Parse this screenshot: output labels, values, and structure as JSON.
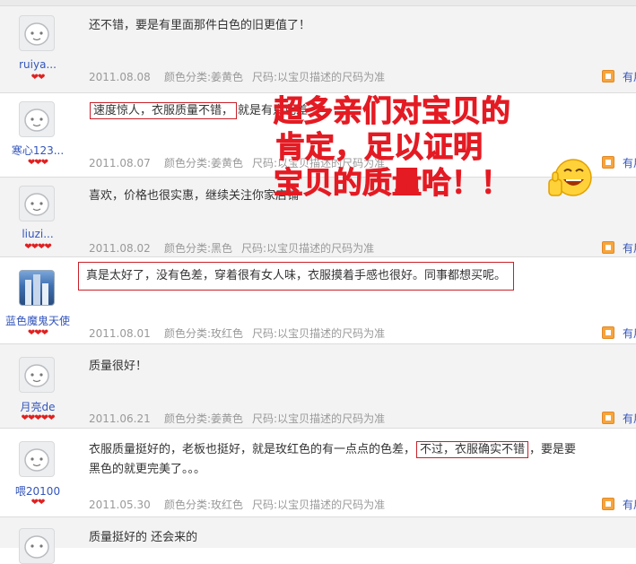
{
  "reviews": [
    {
      "user": "ruiya...",
      "hearts": "❤❤",
      "content": "还不错，要是有里面那件白色的旧更值了！",
      "date": "2011.08.08",
      "color": "颜色分类:姜黄色",
      "size": "尺码:以宝贝描述的尺码为准",
      "link": "有用"
    },
    {
      "user": "寒心123...",
      "hearts": "❤❤❤",
      "content_highlight": "速度惊人，衣服质量不错，",
      "content_rest": "就是有点色差",
      "date": "2011.08.07",
      "color": "颜色分类:姜黄色",
      "size": "尺码:以宝贝描述的尺码为准",
      "link": "有用"
    },
    {
      "user": "liuzi...",
      "hearts": "❤❤❤❤",
      "content": "喜欢，价格也很实惠，继续关注你家店铺",
      "date": "2011.08.02",
      "color": "颜色分类:黑色",
      "size": "尺码:以宝贝描述的尺码为准",
      "link": "有用"
    },
    {
      "user": "蓝色魔鬼天使",
      "hearts": "❤❤❤",
      "content": "真是太好了，没有色差，穿着很有女人味，衣服摸着手感也很好。同事都想买呢。",
      "date": "2011.08.01",
      "color": "颜色分类:玫红色",
      "size": "尺码:以宝贝描述的尺码为准",
      "link": "有用"
    },
    {
      "user": "月亮de",
      "hearts": "❤❤❤❤❤",
      "content": "质量很好！",
      "date": "2011.06.21",
      "color": "颜色分类:姜黄色",
      "size": "尺码:以宝贝描述的尺码为准",
      "link": "有用"
    },
    {
      "user": "喂20100",
      "hearts": "❤❤",
      "content_pre": "衣服质量挺好的，老板也挺好，就是玫红色的有一点点的色差，",
      "content_highlight": "不过，衣服确实不错",
      "content_post": "，要是要",
      "content_line2": "黑色的就更完美了。。。",
      "date": "2011.05.30",
      "color": "颜色分类:玫红色",
      "size": "尺码:以宝贝描述的尺码为准",
      "link": "有用"
    },
    {
      "content": "质量挺好的 还会来的"
    }
  ],
  "overlay": {
    "line1": "超多亲们对宝贝的",
    "line2": "肯定，足以证明",
    "line3": "宝贝的质量哈！！"
  },
  "colors": {
    "accent_red": "#e41b23",
    "link_blue": "#3355bb",
    "meta_gray": "#999999"
  }
}
